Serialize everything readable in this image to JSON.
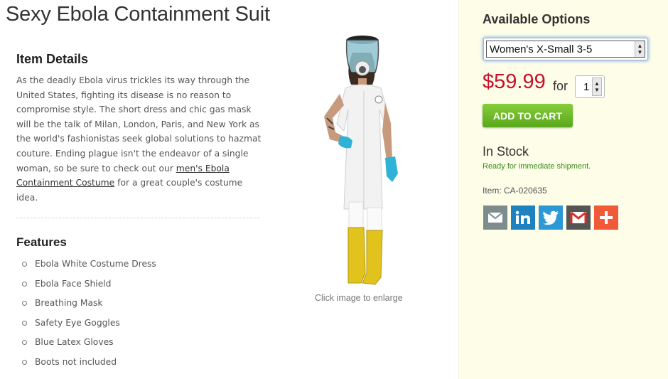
{
  "product": {
    "title": "Sexy Ebola Containment Suit",
    "image_caption": "Click image to enlarge"
  },
  "details": {
    "heading": "Item Details",
    "text_before_link": "As the deadly Ebola virus trickles its way through the United States, fighting its disease is no reason to compromise style. The short dress and chic gas mask will be the talk of Milan, London, Paris, and New York as the world's fashionistas seek global solutions to hazmat couture. Ending plague isn't the endeavor of a single woman, so be sure to check out our ",
    "link_text": "men's Ebola Containment Costume",
    "text_after_link": " for a great couple's costume idea."
  },
  "features": {
    "heading": "Features",
    "items": [
      "Ebola White Costume Dress",
      "Ebola Face Shield",
      "Breathing Mask",
      "Safety Eye Goggles",
      "Blue Latex Gloves",
      "Boots not included"
    ]
  },
  "options": {
    "heading": "Available Options",
    "size_selected": "Women's X-Small 3-5",
    "price": "$59.99",
    "for_label": "for",
    "quantity": "1",
    "add_to_cart_label": "ADD TO CART",
    "stock_status": "In Stock",
    "stock_note": "Ready for immediate shipment.",
    "item_number": "Item: CA-020635"
  },
  "share": {
    "icons": [
      "email-icon",
      "linkedin-icon",
      "twitter-icon",
      "gmail-icon",
      "plus-icon"
    ]
  },
  "colors": {
    "price": "#c8102e",
    "add_to_cart": "#6cb82a",
    "stock_note": "#3a8b1c",
    "sidebar_bg": "#fdfde8",
    "gloves": "#2fb2d8",
    "boots": "#e2c21c"
  }
}
